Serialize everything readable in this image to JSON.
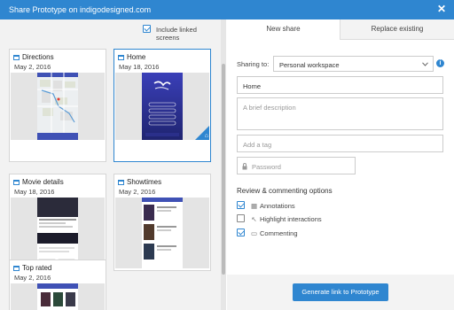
{
  "window": {
    "title": "Share Prototype on indigodesigned.com",
    "close_glyph": "✕"
  },
  "left": {
    "include_linked_label": "Include linked screens",
    "include_linked_checked": true,
    "screens": [
      {
        "title": "Directions",
        "date": "May 2, 2016",
        "selected": false
      },
      {
        "title": "Home",
        "date": "May 18, 2016",
        "selected": true
      },
      {
        "title": "Movie details",
        "date": "May 18, 2016",
        "selected": false
      },
      {
        "title": "Showtimes",
        "date": "May 2, 2016",
        "selected": false
      },
      {
        "title": "Top rated",
        "date": "May 2, 2016",
        "selected": false
      }
    ]
  },
  "right": {
    "tabs": [
      {
        "label": "New share",
        "active": true
      },
      {
        "label": "Replace existing",
        "active": false
      }
    ],
    "sharing_to_label": "Sharing to:",
    "workspace_value": "Personal workspace",
    "name_value": "Home",
    "description_placeholder": "A brief description",
    "tag_placeholder": "Add a tag",
    "password_placeholder": "Password",
    "section_title": "Review & commenting options",
    "options": [
      {
        "label": "Annotations",
        "checked": true,
        "icon": "annotation-icon"
      },
      {
        "label": "Highlight interactions",
        "checked": false,
        "icon": "pointer-icon"
      },
      {
        "label": "Commenting",
        "checked": true,
        "icon": "comment-icon"
      }
    ],
    "generate_label": "Generate link to Prototype"
  },
  "colors": {
    "accent": "#2f86d0",
    "panel": "#f2f2f2"
  }
}
